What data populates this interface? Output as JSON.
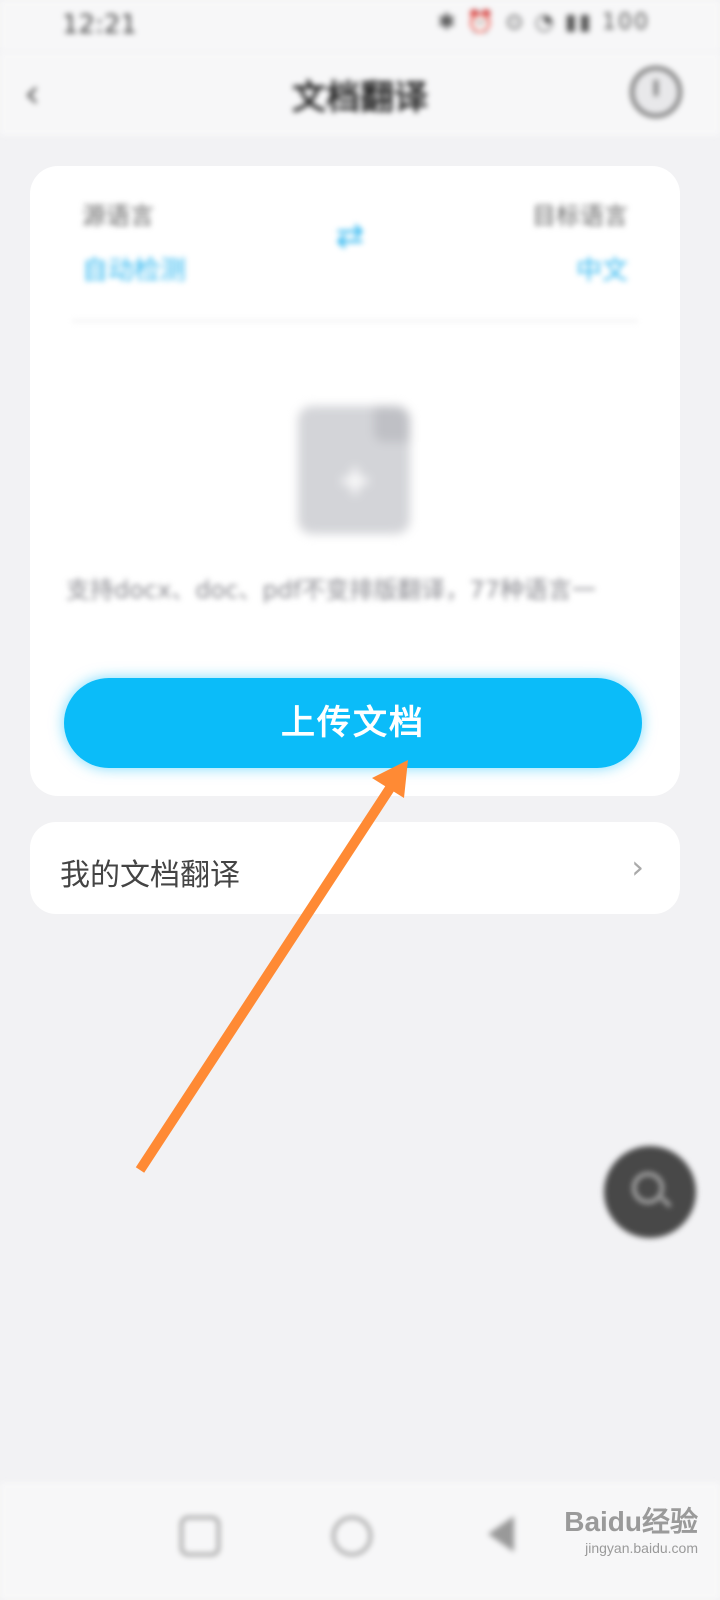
{
  "status_bar": {
    "time": "12:21",
    "icons": "✱ ⏰ ⊙ ◔ ▮▮ 100"
  },
  "header": {
    "title": "文档翻译"
  },
  "language_selector": {
    "source_caption": "源语言",
    "source_value": "自动检测",
    "target_caption": "目标语言",
    "target_value": "中文"
  },
  "upload": {
    "support_text": "支持docx、doc、pdf不变排版翻译，77种语言一",
    "button_label": "上传文档"
  },
  "my_docs": {
    "label": "我的文档翻译"
  },
  "watermark": {
    "brand": "Baidu经验",
    "url": "jingyan.baidu.com"
  },
  "colors": {
    "accent": "#0bbcf9",
    "annotation_arrow": "#ff8a34",
    "background": "#f2f2f4"
  }
}
